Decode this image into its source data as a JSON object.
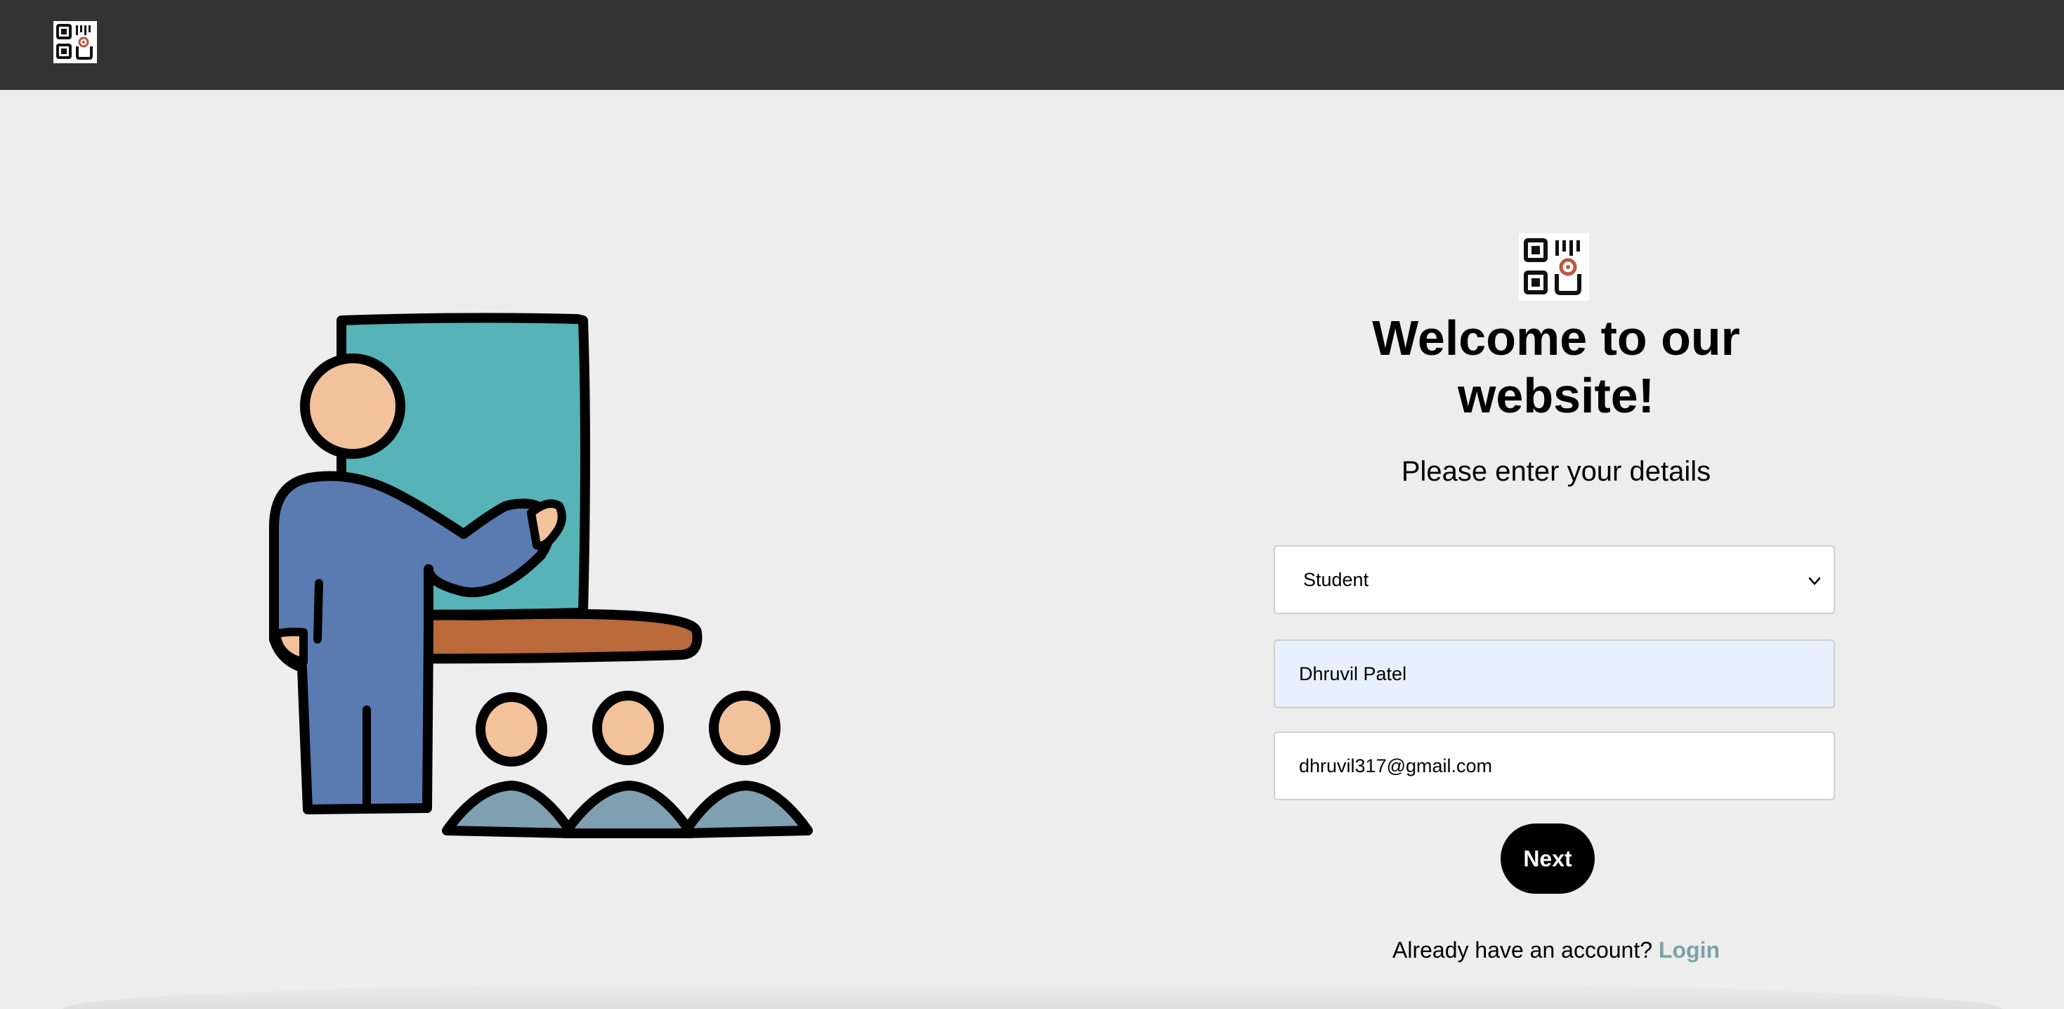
{
  "brand": {
    "logo_icon": "qr-code-logo-icon",
    "accent": "#c0553f"
  },
  "header": {
    "background": "#333333"
  },
  "form": {
    "title": "Welcome to our website!",
    "subtitle": "Please enter your details",
    "role_select": {
      "selected": "Student",
      "icon": "chevron-down-icon"
    },
    "name_input": {
      "value": "Dhruvil Patel"
    },
    "email_input": {
      "value": "dhruvil317@gmail.com"
    },
    "next_button": "Next",
    "account_prompt": "Already have an account?",
    "login_link": "Login",
    "login_color": "#7aa3a8"
  },
  "illustration": {
    "icon": "teacher-at-blackboard-illustration",
    "board_color": "#56b4b8",
    "shelf_color": "#b9693a",
    "shirt_color": "#5a7bb1",
    "skin_color": "#f2c29b",
    "audience_color": "#7fa0b0"
  }
}
